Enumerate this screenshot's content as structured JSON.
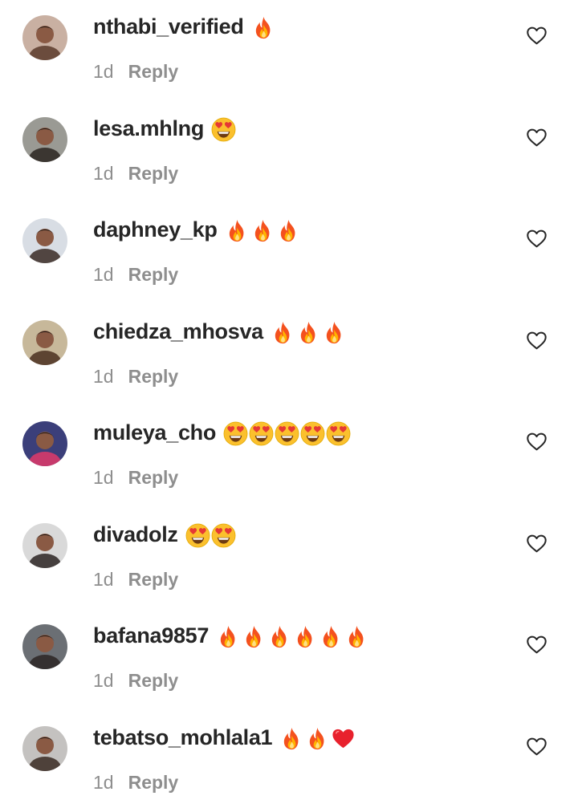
{
  "comments": [
    {
      "username": "nthabi_verified",
      "emojis": [
        "fire"
      ],
      "time": "1d",
      "reply_label": "Reply",
      "avatar_colors": [
        "#c9b0a2",
        "#5a3b2c"
      ]
    },
    {
      "username": "lesa.mhlng",
      "emojis": [
        "heart-eyes"
      ],
      "time": "1d",
      "reply_label": "Reply",
      "avatar_colors": [
        "#9a9a94",
        "#2a2420"
      ]
    },
    {
      "username": "daphney_kp",
      "emojis": [
        "fire",
        "fire",
        "fire"
      ],
      "time": "1d",
      "reply_label": "Reply",
      "avatar_colors": [
        "#d8dde4",
        "#3a2a24"
      ]
    },
    {
      "username": "chiedza_mhosva",
      "emojis": [
        "fire",
        "fire",
        "fire"
      ],
      "time": "1d",
      "reply_label": "Reply",
      "avatar_colors": [
        "#c7b89a",
        "#4a2f20"
      ]
    },
    {
      "username": "muleya_cho",
      "emojis": [
        "heart-eyes",
        "heart-eyes",
        "heart-eyes",
        "heart-eyes",
        "heart-eyes"
      ],
      "time": "1d",
      "reply_label": "Reply",
      "avatar_colors": [
        "#3b3f7a",
        "#e03a6a"
      ]
    },
    {
      "username": "divadolz",
      "emojis": [
        "heart-eyes",
        "heart-eyes"
      ],
      "time": "1d",
      "reply_label": "Reply",
      "avatar_colors": [
        "#d9d9d9",
        "#2b2523"
      ]
    },
    {
      "username": "bafana9857",
      "emojis": [
        "fire",
        "fire",
        "fire",
        "fire",
        "fire",
        "fire"
      ],
      "time": "1d",
      "reply_label": "Reply",
      "avatar_colors": [
        "#6b6f74",
        "#2c2624"
      ]
    },
    {
      "username": "tebatso_mohlala1",
      "emojis": [
        "fire",
        "fire",
        "red-heart"
      ],
      "time": "1d",
      "reply_label": "Reply",
      "avatar_colors": [
        "#c4c2c0",
        "#3a2a22"
      ]
    }
  ],
  "icons": {
    "like": "heart-outline-icon",
    "fire": "fire-emoji-icon",
    "heart-eyes": "heart-eyes-emoji-icon",
    "red-heart": "red-heart-emoji-icon"
  },
  "colors": {
    "username": "#262626",
    "meta": "#8e8e8e",
    "like_icon": "#262626"
  }
}
